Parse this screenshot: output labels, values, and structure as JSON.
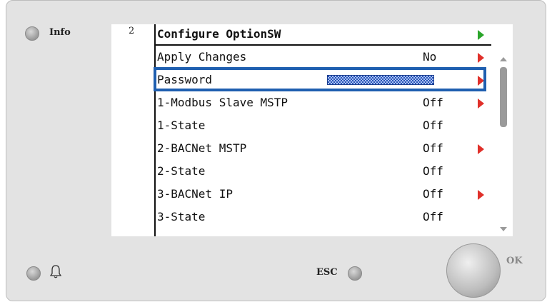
{
  "panel": {
    "info_label": "Info",
    "esc_label": "ESC",
    "ok_label": "OK"
  },
  "screen": {
    "page_number": "2",
    "title": "Configure OptionSW",
    "rows": [
      {
        "name": "Apply Changes",
        "value": "No",
        "arrow": true
      },
      {
        "name": "Password",
        "value": "",
        "arrow": true,
        "masked": true
      },
      {
        "name": "1-Modbus Slave MSTP",
        "value": "Off",
        "arrow": true
      },
      {
        "name": "1-State",
        "value": "Off",
        "arrow": false
      },
      {
        "name": "2-BACNet MSTP",
        "value": "Off",
        "arrow": true
      },
      {
        "name": "2-State",
        "value": "Off",
        "arrow": false
      },
      {
        "name": "3-BACNet IP",
        "value": "Off",
        "arrow": true
      },
      {
        "name": "3-State",
        "value": "Off",
        "arrow": false
      }
    ]
  },
  "colors": {
    "accent_highlight": "#1f5fb0",
    "arrow_red": "#e0302a",
    "arrow_green": "#2aa52a"
  },
  "icons": [
    "bell-icon",
    "scroll-up-icon",
    "scroll-down-icon"
  ]
}
